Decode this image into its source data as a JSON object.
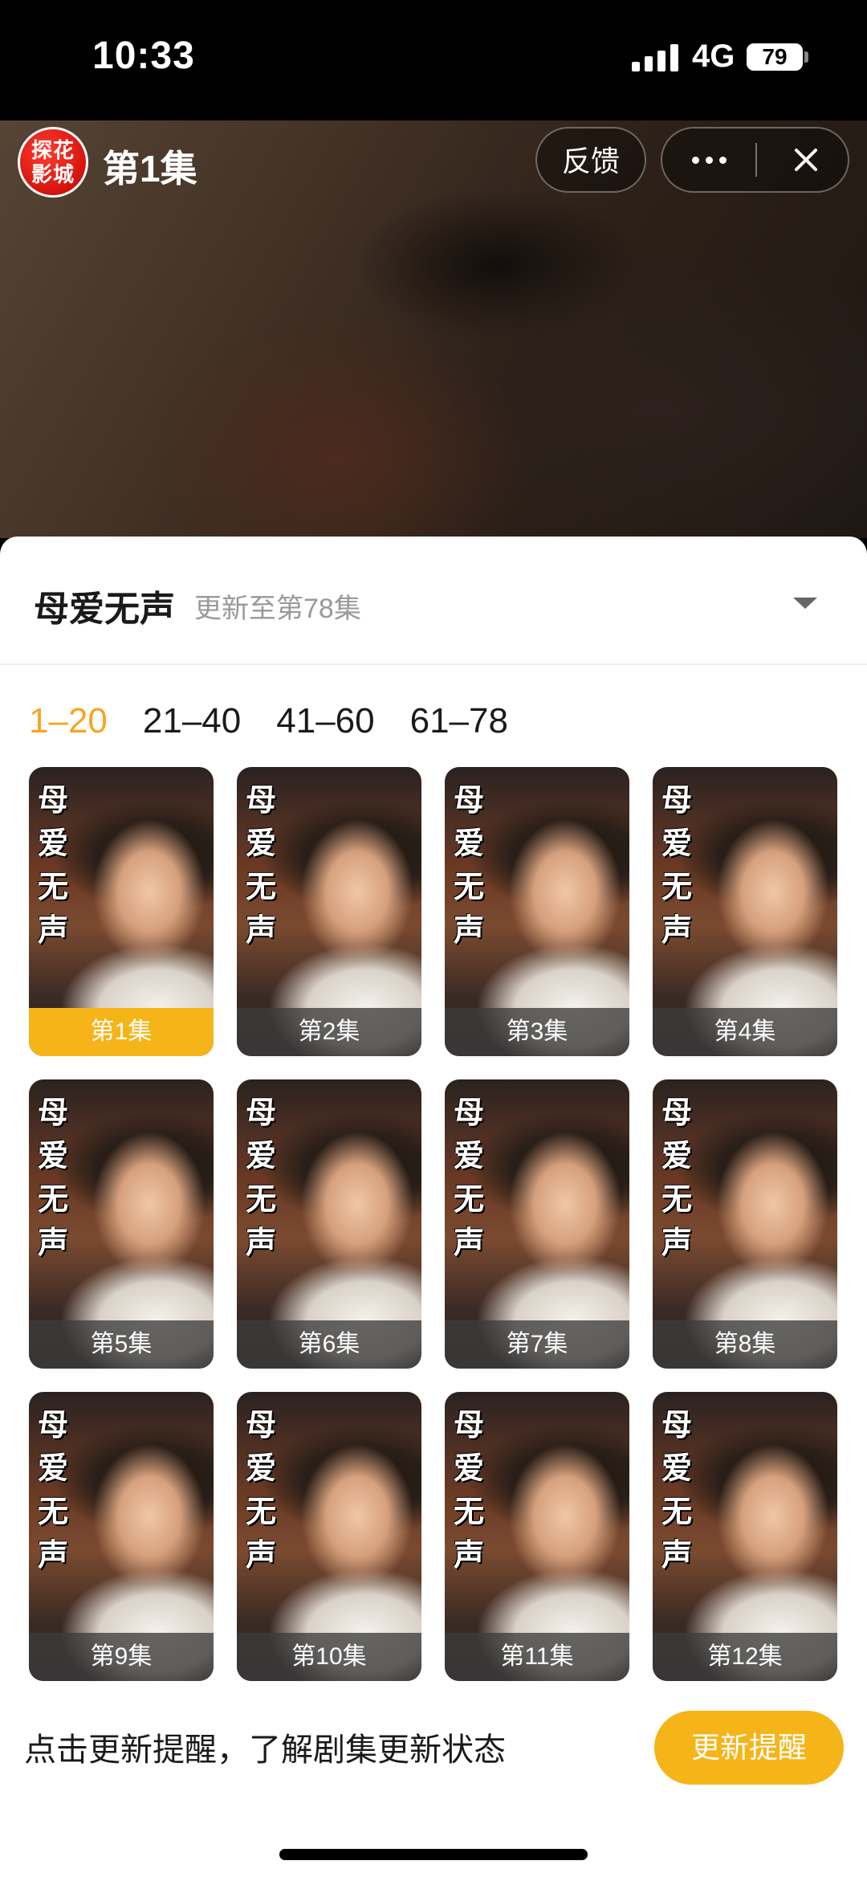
{
  "status_bar": {
    "time": "10:33",
    "network": "4G",
    "battery": "79"
  },
  "header": {
    "logo_text_line1": "探花",
    "logo_text_line2": "影城",
    "title": "第1集",
    "feedback_label": "反馈"
  },
  "series": {
    "title": "母爱无声",
    "update_status": "更新至第78集",
    "poster_title_chars": [
      "母",
      "爱",
      "无",
      "声"
    ]
  },
  "range_tabs": [
    {
      "label": "1–20",
      "active": true
    },
    {
      "label": "21–40",
      "active": false
    },
    {
      "label": "41–60",
      "active": false
    },
    {
      "label": "61–78",
      "active": false
    }
  ],
  "episodes": [
    {
      "label": "第1集",
      "active": true
    },
    {
      "label": "第2集",
      "active": false
    },
    {
      "label": "第3集",
      "active": false
    },
    {
      "label": "第4集",
      "active": false
    },
    {
      "label": "第5集",
      "active": false
    },
    {
      "label": "第6集",
      "active": false
    },
    {
      "label": "第7集",
      "active": false
    },
    {
      "label": "第8集",
      "active": false
    },
    {
      "label": "第9集",
      "active": false
    },
    {
      "label": "第10集",
      "active": false
    },
    {
      "label": "第11集",
      "active": false
    },
    {
      "label": "第12集",
      "active": false
    }
  ],
  "reminder": {
    "text": "点击更新提醒，了解剧集更新状态",
    "button_label": "更新提醒"
  },
  "colors": {
    "accent": "#f5a623",
    "active_episode": "#f5b418"
  },
  "icons": {
    "more": "more-dots-icon",
    "close": "close-icon",
    "dropdown": "chevron-down-icon",
    "signal": "signal-icon",
    "battery": "battery-icon"
  }
}
